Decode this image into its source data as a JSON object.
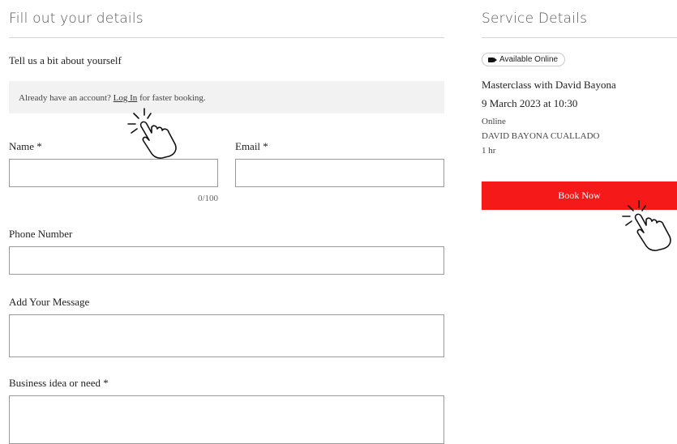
{
  "form": {
    "heading": "Fill out your details",
    "subheading": "Tell us a bit about yourself",
    "login_notice": {
      "prefix": "Already have an account?",
      "link": "Log In",
      "suffix": "for faster booking."
    },
    "name_label": "Name *",
    "name_value": "",
    "name_counter": "0/100",
    "email_label": "Email *",
    "email_value": "",
    "phone_label": "Phone Number",
    "phone_value": "",
    "message_label": "Add Your Message",
    "message_value": "",
    "business_label": "Business idea or need *",
    "business_value": ""
  },
  "service": {
    "heading": "Service Details",
    "badge": "Available Online",
    "badge_icon": "video-camera-icon",
    "title": "Masterclass with David Bayona",
    "datetime": "9 March 2023 at 10:30",
    "location": "Online",
    "host": "DAVID BAYONA CUALLADO",
    "duration": "1 hr",
    "book_label": "Book Now",
    "book_color": "#f5191a"
  },
  "annotations": {
    "pointer_icon": "tap-hand-icon"
  }
}
